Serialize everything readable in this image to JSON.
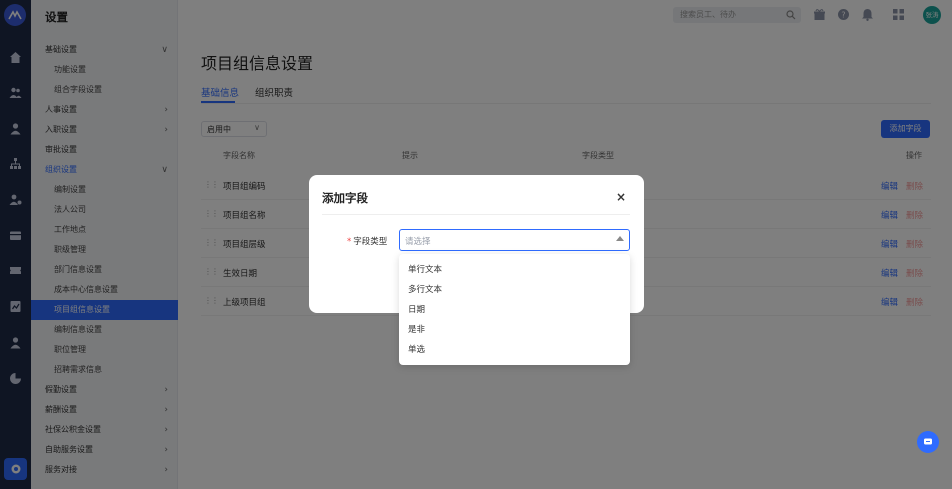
{
  "sidebar": {
    "title": "设置",
    "items": [
      {
        "label": "基础设置",
        "chevron": "∨"
      },
      {
        "label": "功能设置"
      },
      {
        "label": "组合字段设置"
      },
      {
        "label": "人事设置",
        "chevron": "›"
      },
      {
        "label": "入职设置",
        "chevron": "›"
      },
      {
        "label": "审批设置"
      },
      {
        "label": "组织设置",
        "chevron": "∨"
      },
      {
        "label": "编制设置"
      },
      {
        "label": "法人公司"
      },
      {
        "label": "工作地点"
      },
      {
        "label": "职级管理"
      },
      {
        "label": "部门信息设置"
      },
      {
        "label": "成本中心信息设置"
      },
      {
        "label": "项目组信息设置"
      },
      {
        "label": "编制信息设置"
      },
      {
        "label": "职位管理"
      },
      {
        "label": "招聘需求信息"
      },
      {
        "label": "假勤设置",
        "chevron": "›"
      },
      {
        "label": "薪酬设置",
        "chevron": "›"
      },
      {
        "label": "社保公积金设置",
        "chevron": "›"
      },
      {
        "label": "自助服务设置",
        "chevron": "›"
      },
      {
        "label": "服务对接",
        "chevron": "›"
      }
    ]
  },
  "header": {
    "search_placeholder": "搜索员工、待办",
    "avatar_text": "张涛"
  },
  "main": {
    "title": "项目组信息设置",
    "tabs": [
      {
        "label": "基础信息"
      },
      {
        "label": "组织职责"
      }
    ],
    "filter_value": "启用中",
    "filter_chevron": "∨",
    "add_button": "添加字段",
    "columns": [
      "字段名称",
      "提示",
      "字段类型",
      "操作"
    ],
    "rows": [
      {
        "name": "项目组编码",
        "edit": "编辑",
        "delete": "删除"
      },
      {
        "name": "项目组名称",
        "edit": "编辑",
        "delete": "删除"
      },
      {
        "name": "项目组层级",
        "edit": "编辑",
        "delete": "删除"
      },
      {
        "name": "生效日期",
        "edit": "编辑",
        "delete": "删除"
      },
      {
        "name": "上级项目组",
        "edit": "编辑",
        "delete": "删除"
      }
    ],
    "drag_handle": "⋮⋮"
  },
  "modal": {
    "title": "添加字段",
    "close": "×",
    "field_label": "字段类型",
    "required_mark": "*",
    "select_placeholder": "请选择",
    "options": [
      "单行文本",
      "多行文本",
      "日期",
      "是非",
      "单选"
    ]
  },
  "colors": {
    "primary": "#2f6bff",
    "rail": "#1e2a47",
    "danger_faded": "#f39a9a"
  }
}
